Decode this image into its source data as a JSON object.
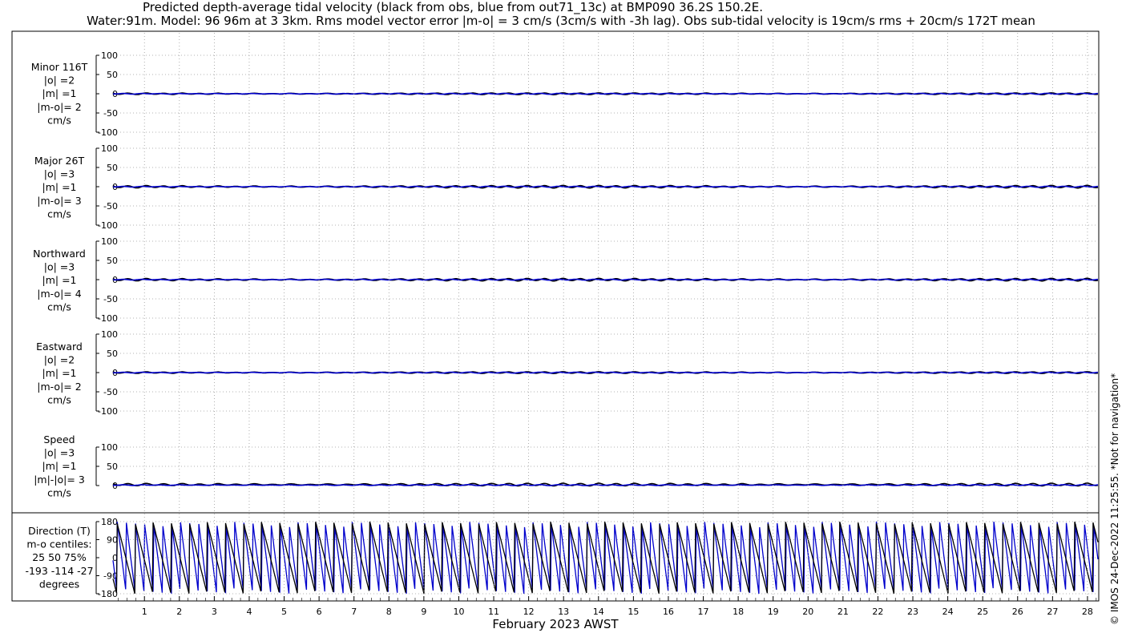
{
  "title_line1": "Predicted depth-average tidal velocity (black from obs, blue from out71_13c) at BMP090 36.2S 150.2E.",
  "title_line2": "Water:91m. Model: 96 96m at 3 3km. Rms model vector error |m-o| = 3 cm/s (3cm/s with -3h lag). Obs sub-tidal velocity is 19cm/s rms + 20cm/s 172T mean",
  "credit": "© IMOS 24-Dec-2022 11:25:55. *Not for navigation*",
  "colors": {
    "obs": "#000000",
    "model": "#0000cc",
    "grid": "#9a9a9a"
  },
  "chart_data": {
    "type": "line",
    "xlabel": "February 2023 AWST",
    "x_ticks": [
      "1",
      "2",
      "3",
      "4",
      "5",
      "6",
      "7",
      "8",
      "9",
      "10",
      "11",
      "12",
      "13",
      "14",
      "15",
      "16",
      "17",
      "18",
      "19",
      "20",
      "21",
      "22",
      "23",
      "24",
      "25",
      "26",
      "27",
      "28"
    ],
    "xlim_days": [
      0.1,
      28.3
    ],
    "grid": true,
    "legend": "none",
    "series_names": [
      "obs",
      "model"
    ],
    "panels": [
      {
        "id": "minor",
        "label_lines": [
          "Minor 116T",
          "|o| =2",
          "|m| =1",
          "|m-o|= 2",
          "cm/s"
        ],
        "yticks": [
          "100",
          "50",
          "0",
          "-50",
          "-100"
        ],
        "ylim": [
          -100,
          100
        ],
        "obs_amplitude": 2,
        "model_amplitude": 1
      },
      {
        "id": "major",
        "label_lines": [
          "Major 26T",
          "|o| =3",
          "|m| =1",
          "|m-o|= 3",
          "cm/s"
        ],
        "yticks": [
          "100",
          "50",
          "0",
          "-50",
          "-100"
        ],
        "ylim": [
          -100,
          100
        ],
        "obs_amplitude": 3,
        "model_amplitude": 1
      },
      {
        "id": "northward",
        "label_lines": [
          "Northward",
          "|o| =3",
          "|m| =1",
          "|m-o|= 4",
          "cm/s"
        ],
        "yticks": [
          "100",
          "50",
          "0",
          "-50",
          "-100"
        ],
        "ylim": [
          -100,
          100
        ],
        "obs_amplitude": 3,
        "model_amplitude": 1
      },
      {
        "id": "eastward",
        "label_lines": [
          "Eastward",
          "|o| =2",
          "|m| =1",
          "|m-o|= 2",
          "cm/s"
        ],
        "yticks": [
          "100",
          "50",
          "0",
          "-50",
          "-100"
        ],
        "ylim": [
          -100,
          100
        ],
        "obs_amplitude": 2,
        "model_amplitude": 1
      },
      {
        "id": "speed",
        "label_lines": [
          "Speed",
          "|o| =3",
          "|m| =1",
          "|m|-|o|= 3",
          "cm/s"
        ],
        "yticks": [
          "100",
          "50",
          "0"
        ],
        "ylim": [
          0,
          100
        ],
        "obs_amplitude": 3,
        "model_amplitude": 1
      },
      {
        "id": "direction",
        "label_lines": [
          "Direction (T)",
          "m-o centiles:",
          "25  50  75%",
          "-193 -114  -27",
          "degrees"
        ],
        "yticks": [
          "180",
          "90",
          "0",
          "-90",
          "-180"
        ],
        "ylim": [
          -180,
          180
        ],
        "obs_period_hours": 12.42,
        "model_period_hours": 12.42
      }
    ]
  }
}
